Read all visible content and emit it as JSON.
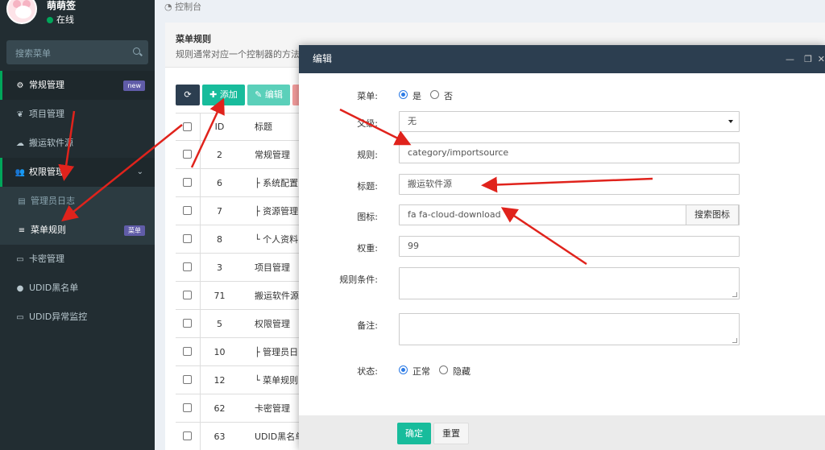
{
  "user": {
    "name": "萌萌签",
    "status": "在线"
  },
  "sidebar": {
    "search_placeholder": "搜索菜单",
    "items": [
      {
        "label": "常规管理",
        "icon": "cogs-icon",
        "badge": "new"
      },
      {
        "label": "项目管理",
        "icon": "leaf-icon"
      },
      {
        "label": "搬运软件源",
        "icon": "cloud-download-icon"
      },
      {
        "label": "权限管理",
        "icon": "users-icon"
      },
      {
        "label": "管理员日志",
        "icon": "list-alt-icon"
      },
      {
        "label": "菜单规则",
        "icon": "bars-icon",
        "badge": "菜单"
      },
      {
        "label": "卡密管理",
        "icon": "id-card-icon"
      },
      {
        "label": "UDID黑名单",
        "icon": "bomb-icon"
      },
      {
        "label": "UDID异常监控",
        "icon": "desktop-icon"
      }
    ]
  },
  "breadcrumb": "控制台",
  "panel": {
    "title": "菜单规则",
    "desc": "规则通常对应一个控制器的方法"
  },
  "toolbar": {
    "add": "添加",
    "edit": "编辑"
  },
  "table": {
    "headers": {
      "id": "ID",
      "title": "标题"
    },
    "rows": [
      {
        "id": "2",
        "title": "常规管理"
      },
      {
        "id": "6",
        "title": "├ 系统配置"
      },
      {
        "id": "7",
        "title": "├ 资源管理"
      },
      {
        "id": "8",
        "title": "└ 个人资料"
      },
      {
        "id": "3",
        "title": "项目管理"
      },
      {
        "id": "71",
        "title": "搬运软件源"
      },
      {
        "id": "5",
        "title": "权限管理"
      },
      {
        "id": "10",
        "title": "├ 管理员日"
      },
      {
        "id": "12",
        "title": "└ 菜单规则"
      },
      {
        "id": "62",
        "title": "卡密管理"
      },
      {
        "id": "63",
        "title": "UDID黑名单"
      }
    ]
  },
  "modal": {
    "title": "编辑",
    "menu_label": "菜单:",
    "yes": "是",
    "no": "否",
    "parent_label": "父级:",
    "parent_value": "无",
    "rule_label": "规则:",
    "rule_value": "category/importsource",
    "title_label": "标题:",
    "title_value": "搬运软件源",
    "icon_label": "图标:",
    "icon_value": "fa fa-cloud-download",
    "icon_search": "搜索图标",
    "weight_label": "权重:",
    "weight_value": "99",
    "condition_label": "规则条件:",
    "remark_label": "备注:",
    "status_label": "状态:",
    "status_normal": "正常",
    "status_hidden": "隐藏",
    "ok": "确定",
    "reset": "重置"
  },
  "colors": {
    "sidebar": "#222d32",
    "accent": "#18bc9c",
    "modal_header": "#2c3e50",
    "arrow": "#e0231c"
  }
}
